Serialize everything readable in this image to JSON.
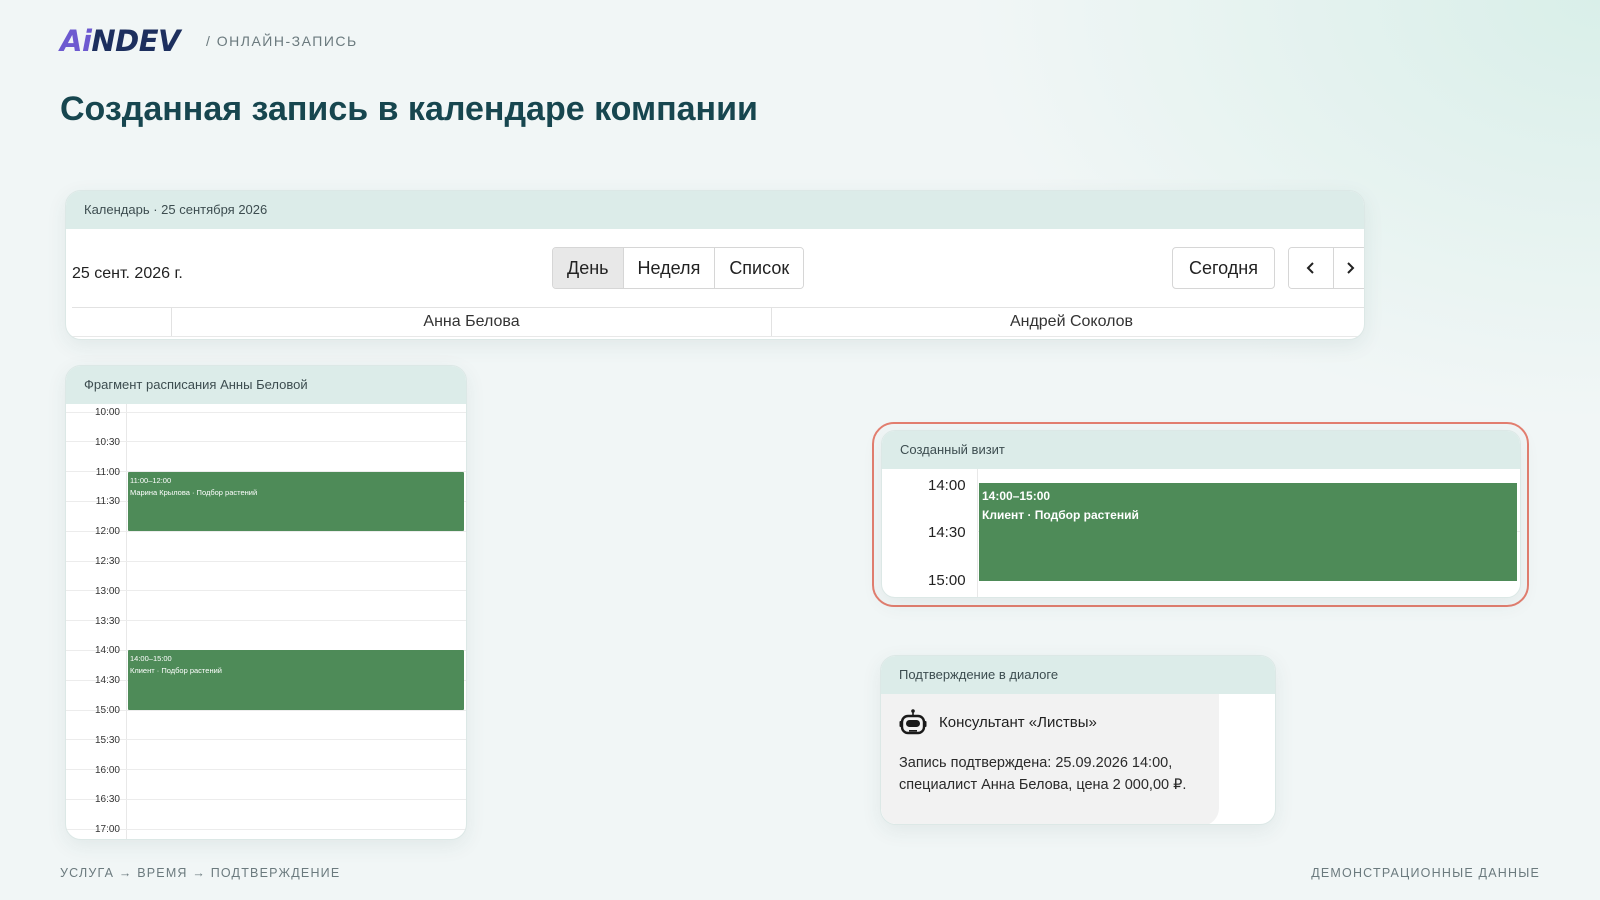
{
  "brand": {
    "logo_accent": "Ai",
    "logo_rest": "NDEV",
    "crumb": "/ ОНЛАЙН-ЗАПИСЬ"
  },
  "page_title": "Созданная запись в календаре компании",
  "calendar": {
    "header": "Календарь · 25 сентября 2026",
    "date_label": "25 сент. 2026 г.",
    "views": [
      "День",
      "Неделя",
      "Список"
    ],
    "active_view": "День",
    "today_label": "Сегодня",
    "prev_icon": "chevron-left-icon",
    "next_icon": "chevron-right-icon",
    "resources": [
      "Анна Белова",
      "Андрей Соколов"
    ]
  },
  "schedule": {
    "header": "Фрагмент расписания Анны Беловой",
    "times": [
      "10:00",
      "10:30",
      "11:00",
      "11:30",
      "12:00",
      "12:30",
      "13:00",
      "13:30",
      "14:00",
      "14:30",
      "15:00",
      "15:30",
      "16:00",
      "16:30",
      "17:00"
    ],
    "events": [
      {
        "time": "11:00–12:00",
        "title": "Марина Крылова · Подбор растений",
        "start": "11:00",
        "end": "12:00"
      },
      {
        "time": "14:00–15:00",
        "title": "Клиент · Подбор растений",
        "start": "14:00",
        "end": "15:00"
      }
    ]
  },
  "visit": {
    "header": "Созданный визит",
    "times": [
      "14:00",
      "14:30",
      "15:00"
    ],
    "event": {
      "time": "14:00–15:00",
      "title": "Клиент · Подбор растений"
    },
    "highlight_color": "#e37e6f"
  },
  "confirmation": {
    "header": "Подтверждение в диалоге",
    "bot_icon": "robot-icon",
    "bot_name": "Консультант «Листвы»",
    "message": "Запись подтверждена: 25.09.2026 14:00, специалист Анна Белова, цена 2 000,00 ₽."
  },
  "footer": {
    "left": "УСЛУГА → ВРЕМЯ → ПОДТВЕРЖДЕНИЕ",
    "right": "ДЕМОНСТРАЦИОННЫЕ ДАННЫЕ"
  },
  "colors": {
    "event_green": "#4e8b58",
    "title_teal": "#17464f",
    "card_head": "#dcece9"
  }
}
